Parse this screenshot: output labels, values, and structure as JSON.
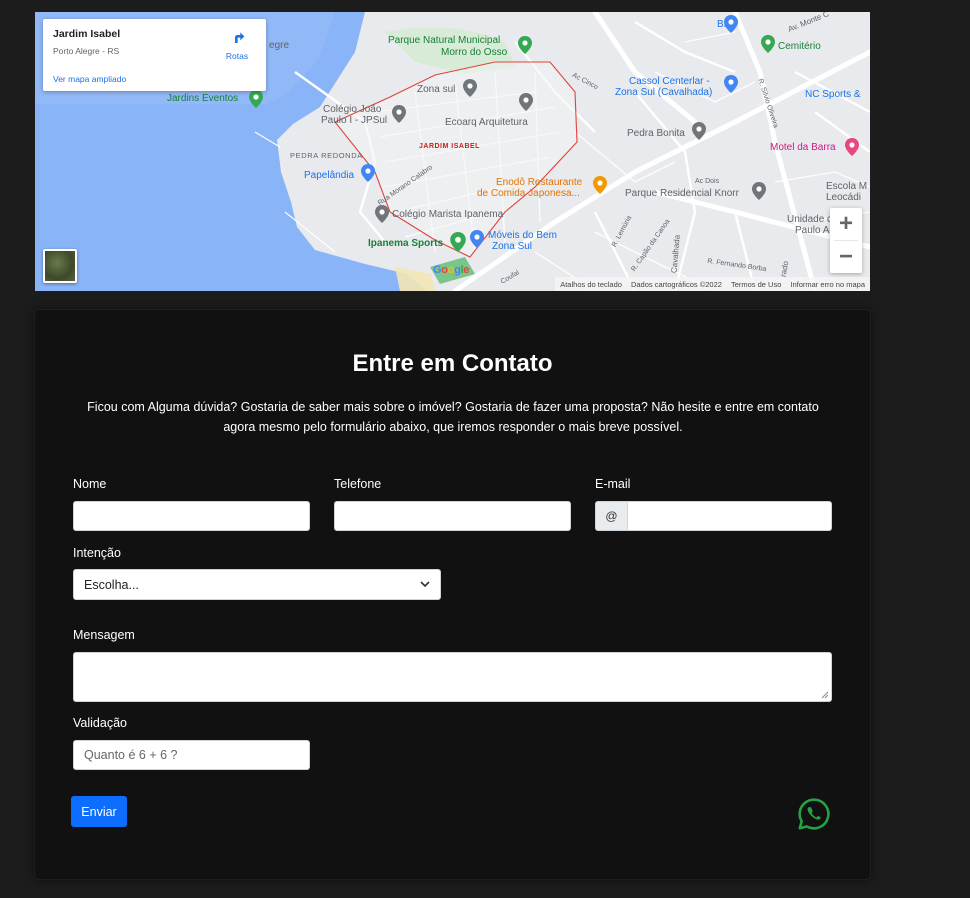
{
  "map": {
    "place_name": "Jardim Isabel",
    "place_address": "Porto Alegre - RS",
    "routes_label": "Rotas",
    "larger_map_link": "Ver mapa ampliado",
    "zoom_in": "+",
    "zoom_out": "−",
    "google_letters": [
      "G",
      "o",
      "o",
      "g",
      "l",
      "e"
    ],
    "attribution": [
      "Atalhos do teclado",
      "Dados cartográficos ©2022",
      "Termos de Uso",
      "Informar erro no mapa"
    ],
    "labels": {
      "parque_natural": "Parque Natural Municipal",
      "morro_osso": "Morro do Osso",
      "zona_sul": "Zona sul",
      "colegio_joao": "Colégio João",
      "paulo_jpsul": "Paulo I - JPSul",
      "ecoarq": "Ecoarq Arquitetura",
      "jardins_eventos": "Jardins Eventos",
      "jardim_isabel": "JARDIM ISABEL",
      "pedra_redonda": "PEDRA REDONDA",
      "papelandia": "Papelândia",
      "cassol_1": "Cassol Centerlar -",
      "cassol_2": "Zona Sul (Cavalhada)",
      "pedra_bonita": "Pedra Bonita",
      "motel": "Motel da Barra",
      "enodo_1": "Enodô Restaurante",
      "enodo_2": "de Comida Japonesa...",
      "parque_res": "Parque Residencial Knorr",
      "colegio_marista": "Colégio Marista Ipanema",
      "moveis_1": "Móveis do Bem",
      "moveis_2": "Zona Sul",
      "ipanema": "Ipanema Sports",
      "big": "BIG",
      "cemiterio": "Cemitério",
      "nc_sports": "NC Sports &",
      "escola_1": "Escola M",
      "escola_2": "Leocádi",
      "unidade_1": "Unidade de Sa",
      "unidade_2": "Paulo A",
      "egre": "egre",
      "ac_cinco": "Ac Cinco",
      "ac_dois": "Ac Dois",
      "av_monte": "Av. Monte C",
      "cavalhada": "Cavalhada",
      "r_fernando": "R. Fernando Borba",
      "r_morano": "Rua Morano Calabro",
      "r_lemuria": "R. Lemúria",
      "r_capao": "R. Capão da Canoa",
      "r_silvio": "R. Silvio Oliveira",
      "coufal": "Coufal",
      "rado": "rado"
    }
  },
  "contact": {
    "title": "Entre em Contato",
    "description": "Ficou com Alguma dúvida? Gostaria de saber mais sobre o imóvel? Gostaria de fazer uma proposta? Não hesite e entre em contato agora mesmo pelo formulário abaixo, que iremos responder o mais breve possível.",
    "name_label": "Nome",
    "phone_label": "Telefone",
    "email_label": "E-mail",
    "email_prefix": "@",
    "intent_label": "Intenção",
    "intent_selected": "Escolha...",
    "message_label": "Mensagem",
    "validation_label": "Validação",
    "validation_placeholder": "Quanto é 6 + 6 ?",
    "submit_label": "Enviar"
  },
  "colors": {
    "page_bg": "#1c1c1c",
    "panel_bg": "#111111",
    "button": "#0d6efd",
    "whatsapp": "#25a244",
    "map_water": "#8ab4f8",
    "map_land": "#e8eaed"
  },
  "icons": [
    "directions-icon",
    "zoom-in-icon",
    "zoom-out-icon",
    "whatsapp-icon",
    "chevron-down-icon",
    "map-pin-icon"
  ]
}
